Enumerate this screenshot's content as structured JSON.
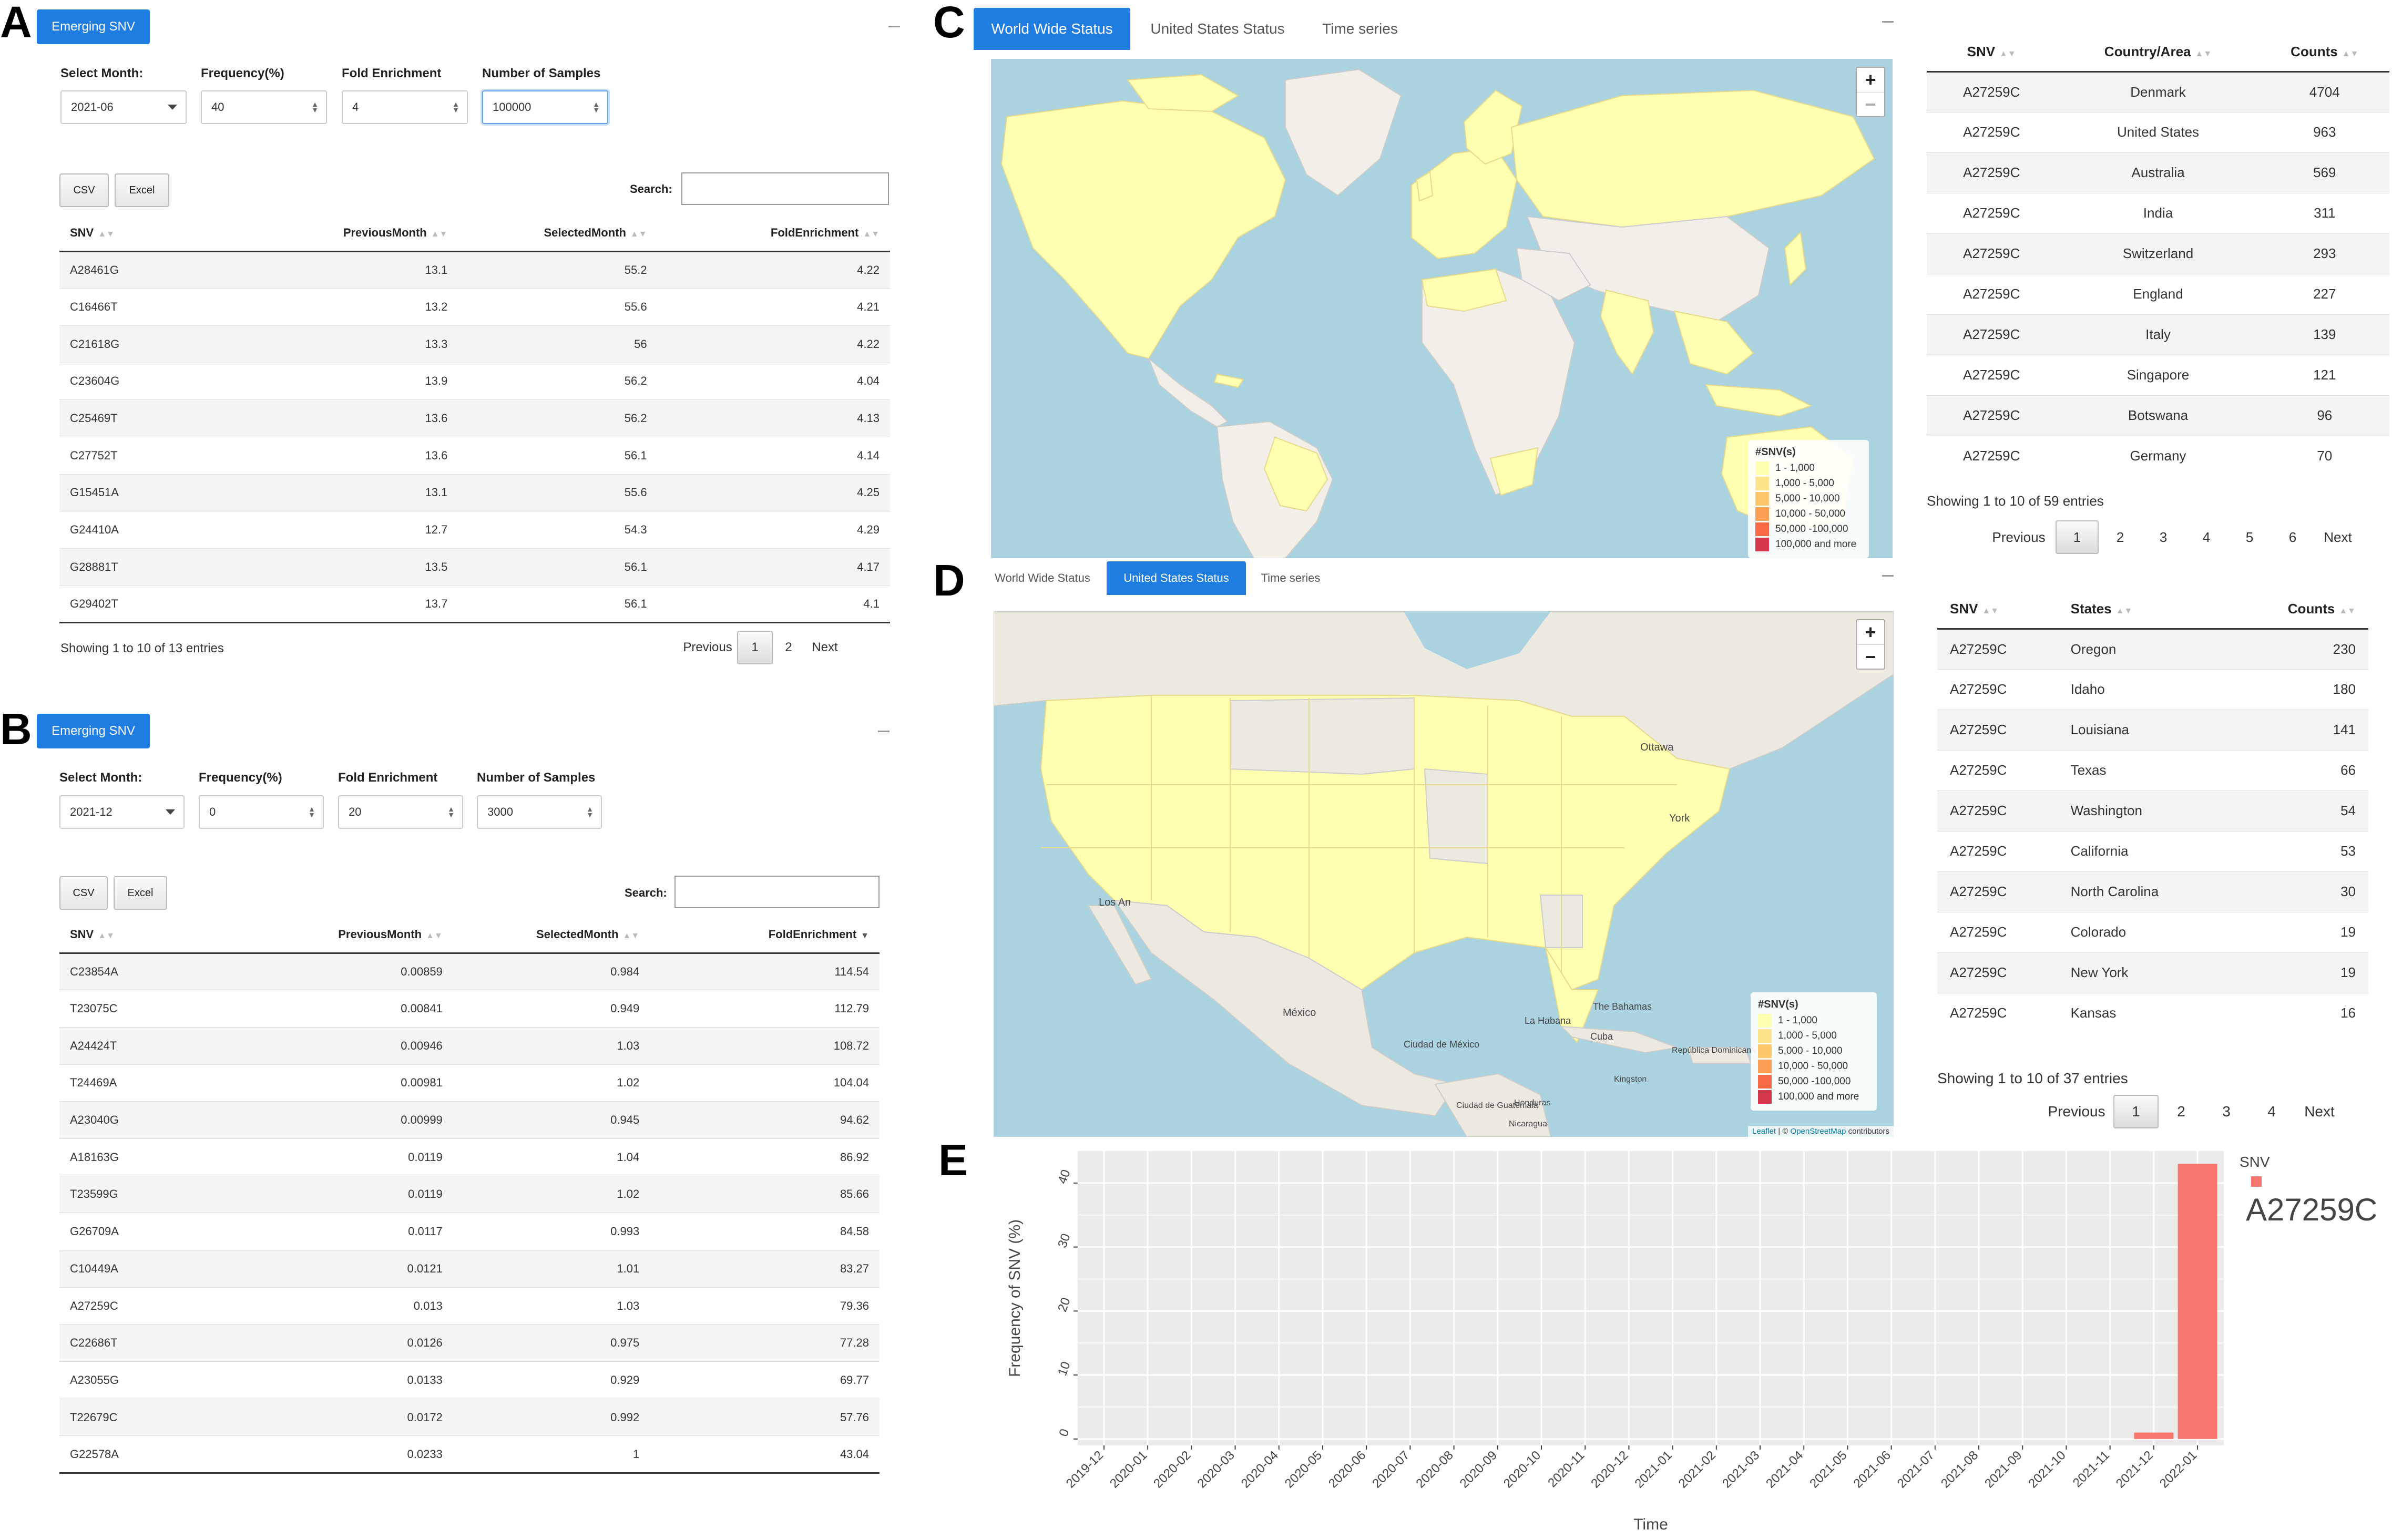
{
  "panels": {
    "A": {
      "letter": "A",
      "header_button": "Emerging SNV",
      "controls": {
        "month": {
          "label": "Select Month:",
          "value": "2021-06"
        },
        "frequency": {
          "label": "Frequency(%)",
          "value": "40"
        },
        "fold": {
          "label": "Fold Enrichment",
          "value": "4"
        },
        "samples": {
          "label": "Number of Samples",
          "value": "100000"
        }
      },
      "export_buttons": {
        "csv": "CSV",
        "excel": "Excel"
      },
      "search_label": "Search:",
      "columns": [
        "SNV",
        "PreviousMonth",
        "SelectedMonth",
        "FoldEnrichment"
      ],
      "rows": [
        [
          "A28461G",
          "13.1",
          "55.2",
          "4.22"
        ],
        [
          "C16466T",
          "13.2",
          "55.6",
          "4.21"
        ],
        [
          "C21618G",
          "13.3",
          "56",
          "4.22"
        ],
        [
          "C23604G",
          "13.9",
          "56.2",
          "4.04"
        ],
        [
          "C25469T",
          "13.6",
          "56.2",
          "4.13"
        ],
        [
          "C27752T",
          "13.6",
          "56.1",
          "4.14"
        ],
        [
          "G15451A",
          "13.1",
          "55.6",
          "4.25"
        ],
        [
          "G24410A",
          "12.7",
          "54.3",
          "4.29"
        ],
        [
          "G28881T",
          "13.5",
          "56.1",
          "4.17"
        ],
        [
          "G29402T",
          "13.7",
          "56.1",
          "4.1"
        ]
      ],
      "info": "Showing 1 to 10 of 13 entries",
      "pager": {
        "previous": "Previous",
        "pages": [
          "1",
          "2"
        ],
        "next": "Next"
      }
    },
    "B": {
      "letter": "B",
      "header_button": "Emerging SNV",
      "controls": {
        "month": {
          "label": "Select Month:",
          "value": "2021-12"
        },
        "frequency": {
          "label": "Frequency(%)",
          "value": "0"
        },
        "fold": {
          "label": "Fold Enrichment",
          "value": "20"
        },
        "samples": {
          "label": "Number of Samples",
          "value": "3000"
        }
      },
      "export_buttons": {
        "csv": "CSV",
        "excel": "Excel"
      },
      "search_label": "Search:",
      "columns": [
        "SNV",
        "PreviousMonth",
        "SelectedMonth",
        "FoldEnrichment"
      ],
      "rows": [
        [
          "C23854A",
          "0.00859",
          "0.984",
          "114.54"
        ],
        [
          "T23075C",
          "0.00841",
          "0.949",
          "112.79"
        ],
        [
          "A24424T",
          "0.00946",
          "1.03",
          "108.72"
        ],
        [
          "T24469A",
          "0.00981",
          "1.02",
          "104.04"
        ],
        [
          "A23040G",
          "0.00999",
          "0.945",
          "94.62"
        ],
        [
          "A18163G",
          "0.0119",
          "1.04",
          "86.92"
        ],
        [
          "T23599G",
          "0.0119",
          "1.02",
          "85.66"
        ],
        [
          "G26709A",
          "0.0117",
          "0.993",
          "84.58"
        ],
        [
          "C10449A",
          "0.0121",
          "1.01",
          "83.27"
        ],
        [
          "A27259C",
          "0.013",
          "1.03",
          "79.36"
        ],
        [
          "C22686T",
          "0.0126",
          "0.975",
          "77.28"
        ],
        [
          "A23055G",
          "0.0133",
          "0.929",
          "69.77"
        ],
        [
          "T22679C",
          "0.0172",
          "0.992",
          "57.76"
        ],
        [
          "G22578A",
          "0.0233",
          "1",
          "43.04"
        ]
      ]
    },
    "C": {
      "letter": "C",
      "tabs": [
        "World Wide Status",
        "United States Status",
        "Time series"
      ],
      "active_tab": 0,
      "legend": {
        "title": "#SNV(s)",
        "items": [
          {
            "label": "1 - 1,000",
            "color": "#ffffb2"
          },
          {
            "label": "1,000 - 5,000",
            "color": "#fee38b"
          },
          {
            "label": "5,000 - 10,000",
            "color": "#fec76b"
          },
          {
            "label": "10,000 - 50,000",
            "color": "#fd9e55"
          },
          {
            "label": "50,000 -100,000",
            "color": "#f76a45"
          },
          {
            "label": "100,000 and more",
            "color": "#d6374a"
          }
        ]
      },
      "table": {
        "columns": [
          "SNV",
          "Country/Area",
          "Counts"
        ],
        "rows": [
          [
            "A27259C",
            "Denmark",
            "4704"
          ],
          [
            "A27259C",
            "United States",
            "963"
          ],
          [
            "A27259C",
            "Australia",
            "569"
          ],
          [
            "A27259C",
            "India",
            "311"
          ],
          [
            "A27259C",
            "Switzerland",
            "293"
          ],
          [
            "A27259C",
            "England",
            "227"
          ],
          [
            "A27259C",
            "Italy",
            "139"
          ],
          [
            "A27259C",
            "Singapore",
            "121"
          ],
          [
            "A27259C",
            "Botswana",
            "96"
          ],
          [
            "A27259C",
            "Germany",
            "70"
          ]
        ],
        "info": "Showing 1 to 10 of 59 entries",
        "pager": {
          "previous": "Previous",
          "pages": [
            "1",
            "2",
            "3",
            "4",
            "5",
            "6"
          ],
          "next": "Next"
        }
      }
    },
    "D": {
      "letter": "D",
      "tabs": [
        "World Wide Status",
        "United States Status",
        "Time series"
      ],
      "active_tab": 1,
      "map_labels": [
        "Ottawa",
        "York",
        "Los An",
        "México",
        "Ciudad de México",
        "La Habana",
        "The Bahamas",
        "Cuba",
        "República Dominicana",
        "Kingston",
        "Ciudad de Guatemala",
        "Honduras",
        "Nicaragua"
      ],
      "attribution": {
        "leaflet": "Leaflet",
        "sep": " | © ",
        "osm": "OpenStreetMap",
        "tail": " contributors"
      },
      "legend": {
        "title": "#SNV(s)",
        "items": [
          {
            "label": "1 - 1,000",
            "color": "#ffffb2"
          },
          {
            "label": "1,000 - 5,000",
            "color": "#fee38b"
          },
          {
            "label": "5,000 - 10,000",
            "color": "#fec76b"
          },
          {
            "label": "10,000 - 50,000",
            "color": "#fd9e55"
          },
          {
            "label": "50,000 -100,000",
            "color": "#f76a45"
          },
          {
            "label": "100,000 and more",
            "color": "#d6374a"
          }
        ]
      },
      "table": {
        "columns": [
          "SNV",
          "States",
          "Counts"
        ],
        "rows": [
          [
            "A27259C",
            "Oregon",
            "230"
          ],
          [
            "A27259C",
            "Idaho",
            "180"
          ],
          [
            "A27259C",
            "Louisiana",
            "141"
          ],
          [
            "A27259C",
            "Texas",
            "66"
          ],
          [
            "A27259C",
            "Washington",
            "54"
          ],
          [
            "A27259C",
            "California",
            "53"
          ],
          [
            "A27259C",
            "North Carolina",
            "30"
          ],
          [
            "A27259C",
            "Colorado",
            "19"
          ],
          [
            "A27259C",
            "New York",
            "19"
          ],
          [
            "A27259C",
            "Kansas",
            "16"
          ]
        ],
        "info": "Showing 1 to 10 of 37 entries",
        "pager": {
          "previous": "Previous",
          "pages": [
            "1",
            "2",
            "3",
            "4"
          ],
          "next": "Next"
        }
      }
    },
    "E": {
      "letter": "E"
    }
  },
  "zoom": {
    "in": "+",
    "out": "−"
  },
  "chart_data": {
    "type": "bar",
    "xlabel": "Time",
    "ylabel": "Frequency of SNV (%)",
    "categories": [
      "2019-12",
      "2020-01",
      "2020-02",
      "2020-03",
      "2020-04",
      "2020-05",
      "2020-06",
      "2020-07",
      "2020-08",
      "2020-09",
      "2020-10",
      "2020-11",
      "2020-12",
      "2021-01",
      "2021-02",
      "2021-03",
      "2021-04",
      "2021-05",
      "2021-06",
      "2021-07",
      "2021-08",
      "2021-09",
      "2021-10",
      "2021-11",
      "2021-12",
      "2022-01"
    ],
    "series": [
      {
        "name": "A27259C",
        "values": [
          0,
          0,
          0,
          0,
          0,
          0,
          0,
          0,
          0,
          0,
          0,
          0,
          0,
          0,
          0,
          0,
          0,
          0,
          0,
          0,
          0,
          0,
          0,
          0,
          1.0,
          43.0
        ],
        "color": "#f8766d"
      }
    ],
    "yticks": [
      0,
      10,
      20,
      30,
      40
    ],
    "ylim": [
      -1,
      45
    ],
    "legend_title": "SNV",
    "legend_position": "right",
    "grid": true
  }
}
